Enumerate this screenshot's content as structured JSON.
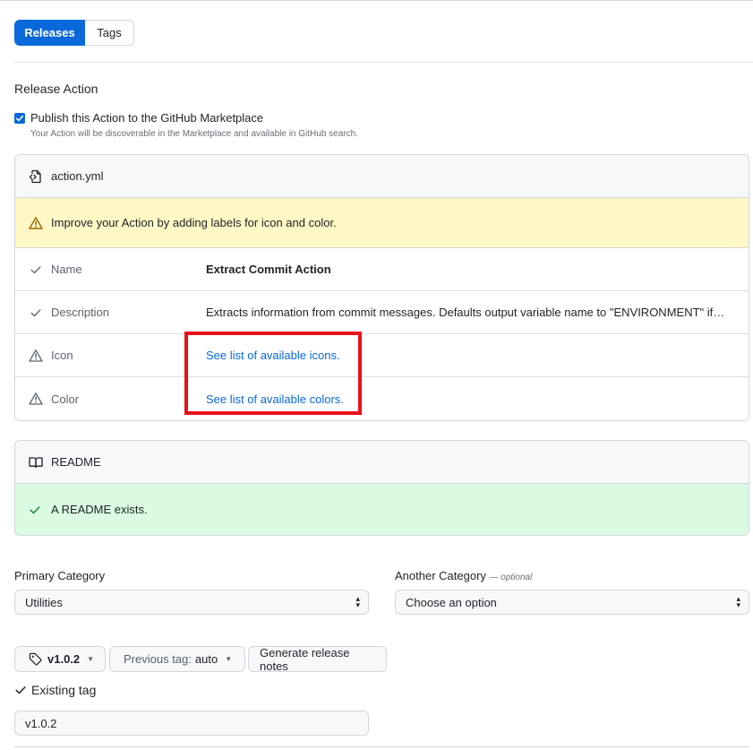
{
  "tabs": {
    "releases": "Releases",
    "tags": "Tags"
  },
  "release_action": {
    "title": "Release Action",
    "publish_label": "Publish this Action to the GitHub Marketplace",
    "publish_checked": true,
    "publish_note": "Your Action will be discoverable in the Marketplace and available in GitHub search."
  },
  "action_file": {
    "filename": "action.yml",
    "warning": "Improve your Action by adding labels for icon and color.",
    "rows": [
      {
        "key": "Name",
        "value": "Extract Commit Action",
        "status": "check"
      },
      {
        "key": "Description",
        "value": "Extracts information from commit messages. Defaults output variable name to \"ENVIRONMENT\" if not ...",
        "status": "check"
      },
      {
        "key": "Icon",
        "value": "See list of available icons.",
        "status": "alert"
      },
      {
        "key": "Color",
        "value": "See list of available colors.",
        "status": "alert"
      }
    ]
  },
  "readme": {
    "title": "README",
    "status_text": "A README exists."
  },
  "categories": {
    "primary_label": "Primary Category",
    "primary_value": "Utilities",
    "another_label": "Another Category",
    "another_optional": "— optional",
    "another_value": "Choose an option"
  },
  "tag_controls": {
    "tag_value": "v1.0.2",
    "previous_label": "Previous tag:",
    "previous_value": "auto",
    "generate_label": "Generate release notes",
    "existing_label": "Existing tag",
    "tag_input_value": "v1.0.2"
  },
  "colors": {
    "accent": "#0969da",
    "warning_bg": "#fff8c5",
    "success_bg": "#dafbe1",
    "highlight": "#e8101b"
  }
}
